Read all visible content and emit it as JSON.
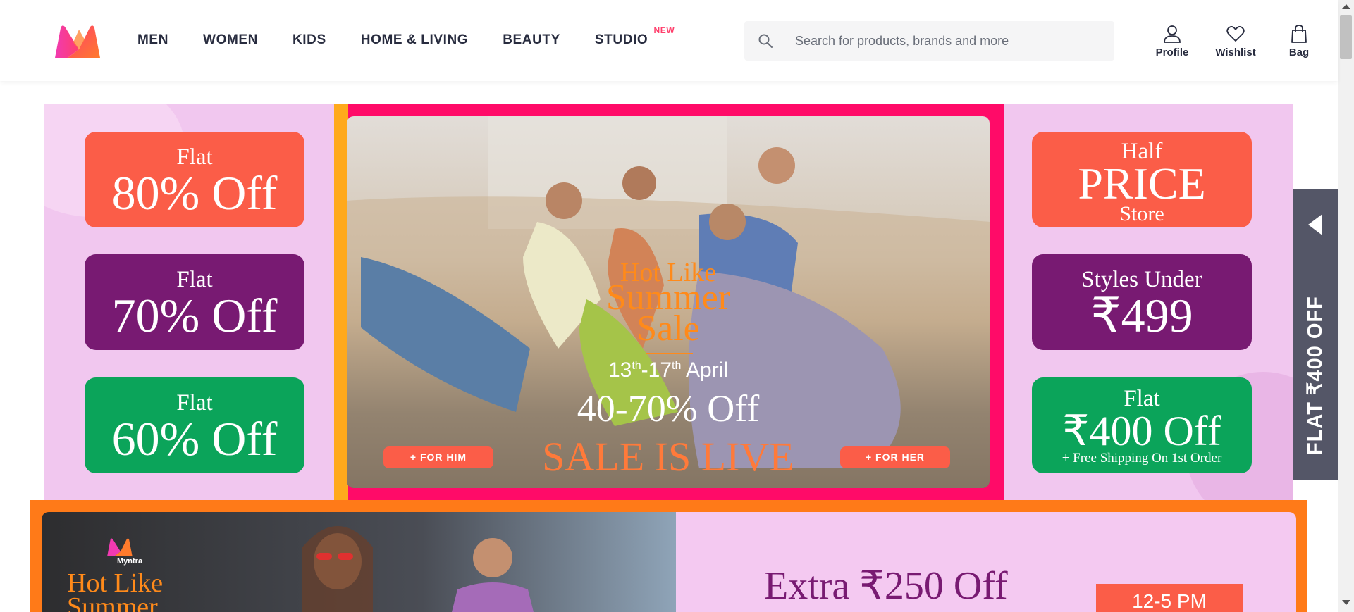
{
  "header": {
    "nav": [
      {
        "label": "MEN"
      },
      {
        "label": "WOMEN"
      },
      {
        "label": "KIDS"
      },
      {
        "label": "HOME & LIVING"
      },
      {
        "label": "BEAUTY"
      },
      {
        "label": "STUDIO",
        "badge": "NEW"
      }
    ],
    "search": {
      "placeholder": "Search for products, brands and more",
      "icon": "search-icon"
    },
    "actions": [
      {
        "label": "Profile",
        "icon": "user-icon"
      },
      {
        "label": "Wishlist",
        "icon": "heart-icon"
      },
      {
        "label": "Bag",
        "icon": "bag-icon"
      }
    ]
  },
  "hero": {
    "left_offers": [
      {
        "small": "Flat",
        "big": "80% Off",
        "color": "#fb5d48"
      },
      {
        "small": "Flat",
        "big": "70% Off",
        "color": "#781a72"
      },
      {
        "small": "Flat",
        "big": "60% Off",
        "color": "#0ba45a"
      }
    ],
    "right_offers": [
      {
        "small": "Half",
        "big": "PRICE",
        "after": "Store",
        "color": "#fb5d48"
      },
      {
        "small": "Styles Under",
        "big": "₹499",
        "color": "#781a72"
      },
      {
        "small": "Flat",
        "big": "₹400 Off",
        "after": "+ Free Shipping On 1st Order",
        "color": "#0ba45a"
      }
    ],
    "center": {
      "line1": "Hot Like",
      "line2": "Summer",
      "line3": "Sale",
      "dates_start": "13",
      "dates_start_sup": "th",
      "dates_end": "-17",
      "dates_end_sup": "th",
      "dates_month": "April",
      "discount": "40-70% Off",
      "sale_live": "SALE IS LIVE",
      "cta_him": "+ FOR HIM",
      "cta_her": "+ FOR HER"
    }
  },
  "side_tab": {
    "label": "FLAT ₹400 OFF"
  },
  "banner2": {
    "logo_label": "Myntra",
    "title_line1": "Hot Like",
    "title_line2": "Summer",
    "extra": "Extra ₹250 Off",
    "time": "12-5 PM"
  },
  "colors": {
    "brand_pink": "#ff3f6c",
    "text_dark": "#282c3f",
    "offer_orange": "#fb5d48",
    "offer_purple": "#781a72",
    "offer_green": "#0ba45a"
  }
}
